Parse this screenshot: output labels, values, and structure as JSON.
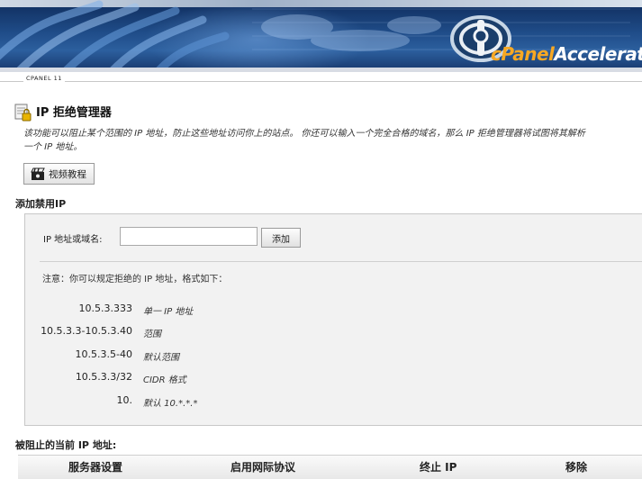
{
  "banner": {
    "brand_cp": "cPanel",
    "brand_rest": "Accelerated"
  },
  "version_label": "CPANEL 11",
  "page": {
    "title": "IP 拒绝管理器",
    "icon": "lock-document-icon",
    "description": "该功能可以阻止某个范围的 IP 地址，防止这些地址访问你上的站点。 你还可以输入一个完全合格的域名，那么 IP 拒绝管理器将试图将其解析\n一个 IP 地址。"
  },
  "video_button": {
    "icon": "clapperboard-icon",
    "label": "视频教程"
  },
  "add_section": {
    "title": "添加禁用IP",
    "field_label": "IP 地址或域名:",
    "input_value": "",
    "input_placeholder": "",
    "add_label": "添加",
    "note": "注意：你可以规定拒绝的 IP 地址，格式如下：",
    "examples": [
      {
        "value": "10.5.3.333",
        "desc": "单一 IP 地址"
      },
      {
        "value": "10.5.3.3-10.5.3.40",
        "desc": "范围"
      },
      {
        "value": "10.5.3.5-40",
        "desc": "默认范围"
      },
      {
        "value": "10.5.3.3/32",
        "desc": "CIDR 格式"
      },
      {
        "value": "10.",
        "desc": "默认 10.*.*.*"
      }
    ]
  },
  "blocked_section": {
    "title": "被阻止的当前 IP 地址:",
    "columns": [
      "服务器设置",
      "启用网际协议",
      "终止 IP",
      "移除"
    ]
  }
}
